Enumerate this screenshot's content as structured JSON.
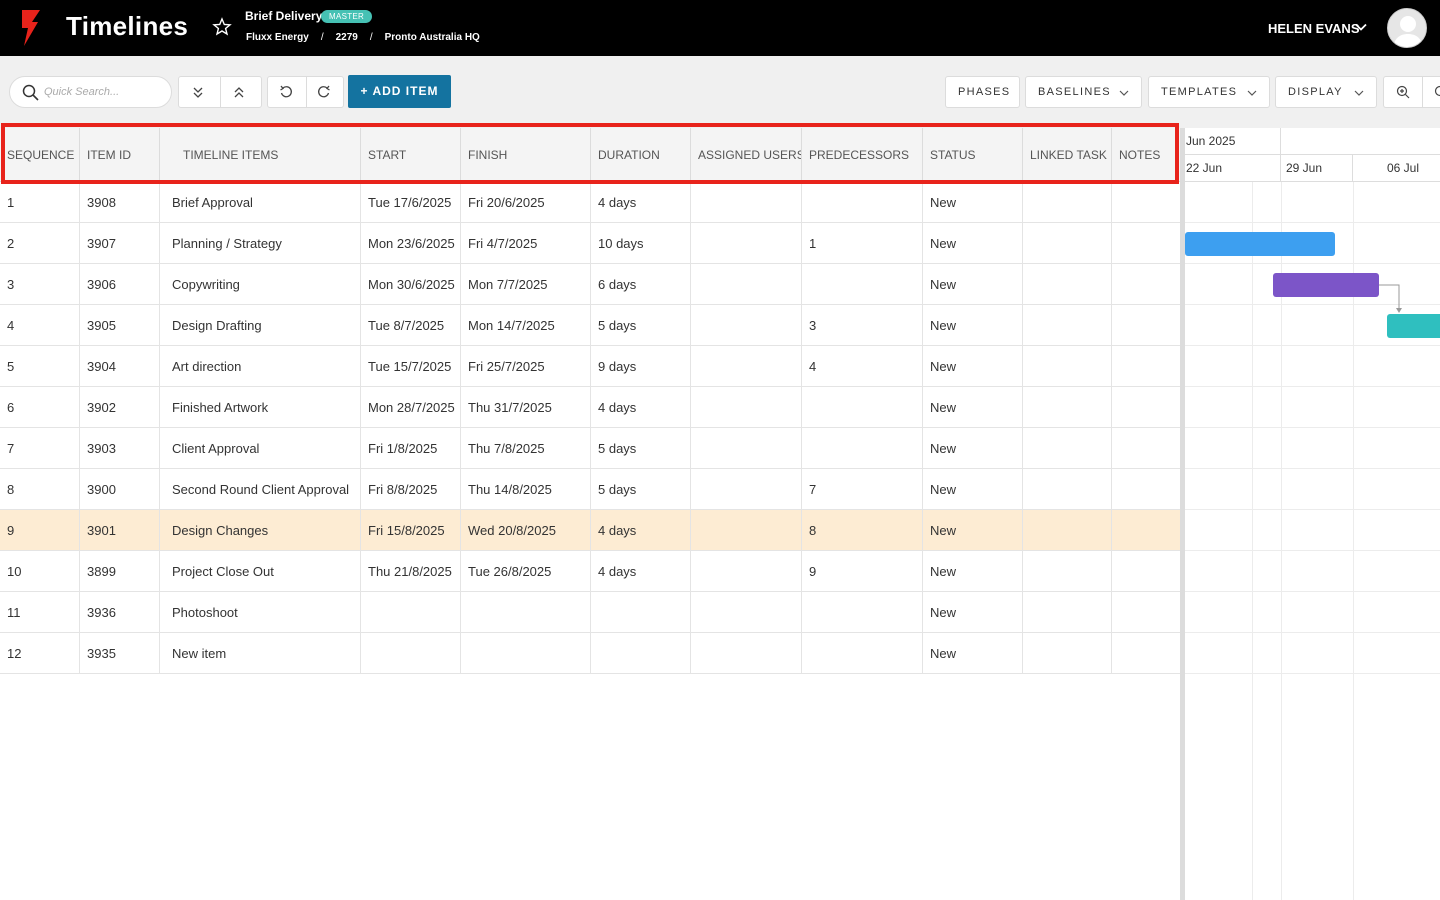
{
  "header": {
    "app_title": "Timelines",
    "project_name": "Brief Delivery",
    "badge": "MASTER",
    "breadcrumbs": [
      "Fluxx Energy",
      "2279",
      "Pronto Australia HQ"
    ],
    "breadcrumb_separator": "/",
    "user_name": "HELEN EVANS"
  },
  "toolbar": {
    "search_placeholder": "Quick Search...",
    "add_item_label": "+ ADD ITEM",
    "phases_label": "PHASES",
    "baselines_label": "BASELINES",
    "templates_label": "TEMPLATES",
    "display_label": "DISPLAY"
  },
  "table": {
    "columns": [
      "SEQUENCE",
      "ITEM ID",
      "TIMELINE ITEMS",
      "START",
      "FINISH",
      "DURATION",
      "ASSIGNED USERS",
      "PREDECESSORS",
      "STATUS",
      "LINKED TASK",
      "NOTES"
    ],
    "selected_row": 9,
    "rows": [
      {
        "seq": "1",
        "id": "3908",
        "name": "Brief Approval",
        "start": "Tue 17/6/2025",
        "finish": "Fri 20/6/2025",
        "duration": "4 days",
        "users": "",
        "pred": "",
        "status": "New",
        "linked": "",
        "notes": ""
      },
      {
        "seq": "2",
        "id": "3907",
        "name": "Planning / Strategy",
        "start": "Mon 23/6/2025",
        "finish": "Fri 4/7/2025",
        "duration": "10 days",
        "users": "",
        "pred": "1",
        "status": "New",
        "linked": "",
        "notes": ""
      },
      {
        "seq": "3",
        "id": "3906",
        "name": "Copywriting",
        "start": "Mon 30/6/2025",
        "finish": "Mon 7/7/2025",
        "duration": "6 days",
        "users": "",
        "pred": "",
        "status": "New",
        "linked": "",
        "notes": ""
      },
      {
        "seq": "4",
        "id": "3905",
        "name": "Design Drafting",
        "start": "Tue 8/7/2025",
        "finish": "Mon 14/7/2025",
        "duration": "5 days",
        "users": "",
        "pred": "3",
        "status": "New",
        "linked": "",
        "notes": ""
      },
      {
        "seq": "5",
        "id": "3904",
        "name": "Art direction",
        "start": "Tue 15/7/2025",
        "finish": "Fri 25/7/2025",
        "duration": "9 days",
        "users": "",
        "pred": "4",
        "status": "New",
        "linked": "",
        "notes": ""
      },
      {
        "seq": "6",
        "id": "3902",
        "name": "Finished Artwork",
        "start": "Mon 28/7/2025",
        "finish": "Thu 31/7/2025",
        "duration": "4 days",
        "users": "",
        "pred": "",
        "status": "New",
        "linked": "",
        "notes": ""
      },
      {
        "seq": "7",
        "id": "3903",
        "name": "Client Approval",
        "start": "Fri 1/8/2025",
        "finish": "Thu 7/8/2025",
        "duration": "5 days",
        "users": "",
        "pred": "",
        "status": "New",
        "linked": "",
        "notes": ""
      },
      {
        "seq": "8",
        "id": "3900",
        "name": "Second Round Client Approval",
        "start": "Fri 8/8/2025",
        "finish": "Thu 14/8/2025",
        "duration": "5 days",
        "users": "",
        "pred": "7",
        "status": "New",
        "linked": "",
        "notes": ""
      },
      {
        "seq": "9",
        "id": "3901",
        "name": "Design Changes",
        "start": "Fri 15/8/2025",
        "finish": "Wed 20/8/2025",
        "duration": "4 days",
        "users": "",
        "pred": "8",
        "status": "New",
        "linked": "",
        "notes": ""
      },
      {
        "seq": "10",
        "id": "3899",
        "name": "Project Close Out",
        "start": "Thu 21/8/2025",
        "finish": "Tue 26/8/2025",
        "duration": "4 days",
        "users": "",
        "pred": "9",
        "status": "New",
        "linked": "",
        "notes": ""
      },
      {
        "seq": "11",
        "id": "3936",
        "name": "Photoshoot",
        "start": "",
        "finish": "",
        "duration": "",
        "users": "",
        "pred": "",
        "status": "New",
        "linked": "",
        "notes": ""
      },
      {
        "seq": "12",
        "id": "3935",
        "name": "New item",
        "start": "",
        "finish": "",
        "duration": "",
        "users": "",
        "pred": "",
        "status": "New",
        "linked": "",
        "notes": ""
      }
    ]
  },
  "gantt": {
    "month_label": "Jun 2025",
    "weeks": [
      "22 Jun",
      "29 Jun",
      "06 Jul"
    ],
    "bar_colors": {
      "planning": "#3d9ff0",
      "copywriting": "#7c55c8",
      "design_drafting": "#2fbfbf"
    }
  },
  "colors": {
    "accent": "#1473a0",
    "badge": "#46c1b4",
    "highlight_border": "#e8231b",
    "selected_row": "#fdecd3",
    "logo_red": "#e8231b"
  }
}
